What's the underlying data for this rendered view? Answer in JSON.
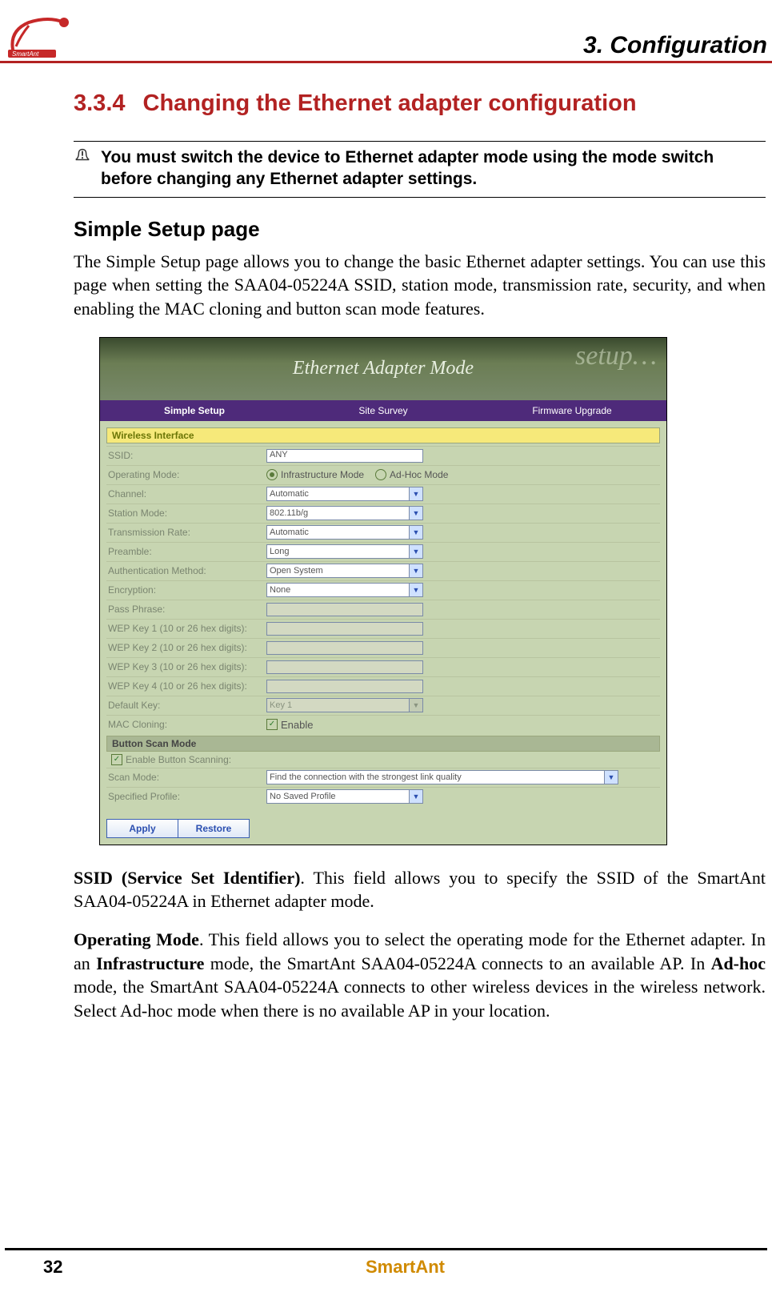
{
  "header": {
    "chapter": "3. Configuration",
    "section_number": "3.3.4",
    "section_title": "Changing the Ethernet adapter configuration"
  },
  "note": {
    "text": "You must switch the device to Ethernet adapter mode using the mode switch before changing any Ethernet adapter settings."
  },
  "simple_setup": {
    "heading": "Simple Setup page",
    "intro": "The Simple Setup page allows you to change the basic Ethernet adapter settings. You can use this page when setting the SAA04-05224A SSID, station mode, transmission rate, security, and when enabling the MAC cloning and button scan mode features."
  },
  "embed": {
    "banner_title": "Ethernet Adapter Mode",
    "banner_right": "setup…",
    "tabs": [
      "Simple Setup",
      "Site Survey",
      "Firmware Upgrade"
    ],
    "section_wireless": "Wireless Interface",
    "labels": {
      "ssid": "SSID:",
      "opmode": "Operating Mode:",
      "channel": "Channel:",
      "station": "Station Mode:",
      "txrate": "Transmission Rate:",
      "preamble": "Preamble:",
      "auth": "Authentication Method:",
      "enc": "Encryption:",
      "pass": "Pass Phrase:",
      "wep1": "WEP Key 1 (10 or 26 hex digits):",
      "wep2": "WEP Key 2 (10 or 26 hex digits):",
      "wep3": "WEP Key 3 (10 or 26 hex digits):",
      "wep4": "WEP Key 4 (10 or 26 hex digits):",
      "defkey": "Default Key:",
      "mac": "MAC Cloning:"
    },
    "values": {
      "ssid": "ANY",
      "op_infra": "Infrastructure Mode",
      "op_adhoc": "Ad-Hoc Mode",
      "channel": "Automatic",
      "station": "802.11b/g",
      "txrate": "Automatic",
      "preamble": "Long",
      "auth": "Open System",
      "enc": "None",
      "defkey": "Key 1",
      "mac_enable": "Enable"
    },
    "scan": {
      "header": "Button Scan Mode",
      "enable_label": "Enable Button Scanning:",
      "scanmode_label": "Scan Mode:",
      "scanmode_value": "Find the connection with the strongest link quality",
      "profile_label": "Specified Profile:",
      "profile_value": "No Saved Profile"
    },
    "buttons": {
      "apply": "Apply",
      "restore": "Restore"
    }
  },
  "paragraphs": {
    "ssid_b1": "SSID (Service Set Identifier)",
    "ssid_rest": ". This field allows you to specify the SSID of the SmartAnt SAA04-05224A in Ethernet adapter mode.",
    "op_b1": "Operating Mode",
    "op_t1": ". This field allows you to select the operating mode for the Ethernet adapter. In an ",
    "op_b2": "Infrastructure",
    "op_t2": " mode, the SmartAnt SAA04-05224A connects to an available AP. In ",
    "op_b3": "Ad-hoc",
    "op_t3": " mode, the SmartAnt SAA04-05224A connects to other wireless devices in the wireless network. Select Ad-hoc mode when there is no available AP in your location."
  },
  "footer": {
    "page": "32",
    "brand": "SmartAnt"
  }
}
